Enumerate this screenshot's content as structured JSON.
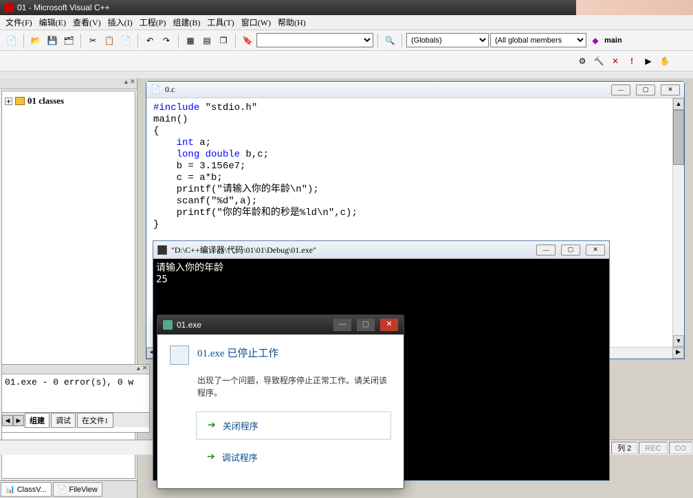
{
  "title": "01 - Microsoft Visual C++",
  "menu": {
    "file": "文件(F)",
    "edit": "编辑(E)",
    "view": "查看(V)",
    "insert": "插入(I)",
    "project": "工程(P)",
    "build": "组建(B)",
    "tools": "工具(T)",
    "window": "窗口(W)",
    "help": "帮助(H)"
  },
  "combo_globals": "(Globals)",
  "combo_members": "(All global members",
  "combo_main": "main",
  "tree": {
    "root": "01 classes"
  },
  "side_tabs": {
    "classview": "ClassV...",
    "fileview": "FileView"
  },
  "code_window": {
    "title": "0.c",
    "lines": [
      {
        "segments": [
          {
            "t": "#include ",
            "c": "kw-blue"
          },
          {
            "t": "\"stdio.h\"",
            "c": ""
          }
        ]
      },
      {
        "segments": [
          {
            "t": "main()",
            "c": ""
          }
        ]
      },
      {
        "segments": [
          {
            "t": "{",
            "c": ""
          }
        ]
      },
      {
        "segments": [
          {
            "t": "    ",
            "c": ""
          },
          {
            "t": "int",
            "c": "kw-blue"
          },
          {
            "t": " a;",
            "c": ""
          }
        ]
      },
      {
        "segments": [
          {
            "t": "    ",
            "c": ""
          },
          {
            "t": "long double",
            "c": "kw-blue"
          },
          {
            "t": " b,c;",
            "c": ""
          }
        ]
      },
      {
        "segments": [
          {
            "t": "    b = 3.156e7;",
            "c": ""
          }
        ]
      },
      {
        "segments": [
          {
            "t": "    c = a*b;",
            "c": ""
          }
        ]
      },
      {
        "segments": [
          {
            "t": "    printf(",
            "c": ""
          },
          {
            "t": "\"请输入你的年龄\\n\"",
            "c": ""
          },
          {
            "t": ");",
            "c": ""
          }
        ]
      },
      {
        "segments": [
          {
            "t": "    scanf(",
            "c": ""
          },
          {
            "t": "\"%d\"",
            "c": ""
          },
          {
            "t": ",a);",
            "c": ""
          }
        ]
      },
      {
        "segments": [
          {
            "t": "    printf(",
            "c": ""
          },
          {
            "t": "\"你的年龄和的秒是%ld\\n\"",
            "c": ""
          },
          {
            "t": ",c);",
            "c": ""
          }
        ]
      },
      {
        "segments": [
          {
            "t": "}",
            "c": ""
          }
        ]
      }
    ]
  },
  "output": {
    "text": "01.exe - 0 error(s), 0 w",
    "tabs": {
      "build": "组建",
      "debug": "调试",
      "find1": "在文件1"
    }
  },
  "status": {
    "col_label": "列",
    "col_val": "2",
    "rec": "REC",
    "col_ovr": "CO"
  },
  "console": {
    "title": "\"D:\\C++编译器\\代码\\01\\01\\Debug\\01.exe\"",
    "line1": "请输入你的年龄",
    "line2": "25"
  },
  "dialog": {
    "title": "01.exe",
    "heading": "01.exe 已停止工作",
    "message": "出现了一个问题，导致程序停止正常工作。请关闭该程序。",
    "opt_close": "关闭程序",
    "opt_debug": "调试程序"
  }
}
